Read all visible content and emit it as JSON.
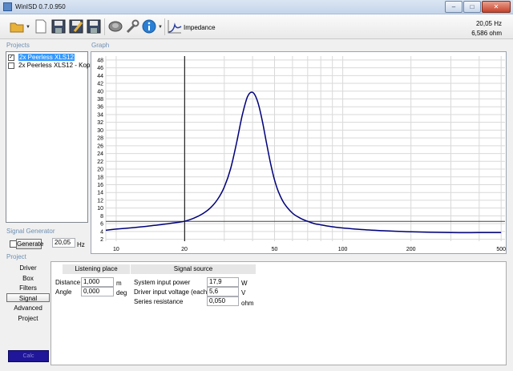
{
  "window": {
    "title": "WinISD 0.7.0.950",
    "min": "–",
    "max": "□",
    "close": "✕"
  },
  "toolbar": {
    "icons": [
      "open-folder",
      "new-document",
      "save",
      "save-as",
      "save-all",
      "speaker-driver",
      "wrench",
      "info"
    ],
    "impedance_label": "Impedance",
    "readout_freq": "20,05 Hz",
    "readout_value": "6,586 ohm"
  },
  "sections": {
    "projects": "Projects",
    "graph": "Graph",
    "signal_generator": "Signal Generator",
    "project": "Project"
  },
  "projects": [
    {
      "name": "2x Peerless XLS12",
      "checked": true,
      "selected": true
    },
    {
      "name": "2x Peerless XLS12 - Kopie",
      "checked": false,
      "selected": false
    }
  ],
  "signal_generator": {
    "button": "Generate",
    "frequency": "20,05",
    "unit": "Hz"
  },
  "project_nav": [
    {
      "label": "Driver",
      "active": false
    },
    {
      "label": "Box",
      "active": false
    },
    {
      "label": "Filters",
      "active": false
    },
    {
      "label": "Signal",
      "active": true
    },
    {
      "label": "Advanced",
      "active": false
    },
    {
      "label": "Project",
      "active": false
    }
  ],
  "listening": {
    "header": "Listening place",
    "distance_label": "Distance",
    "distance_value": "1,000",
    "distance_unit": "m",
    "angle_label": "Angle",
    "angle_value": "0,000",
    "angle_unit": "deg"
  },
  "signal_source": {
    "header": "Signal source",
    "power_label": "System input power",
    "power_value": "17,9",
    "power_unit": "W",
    "voltage_label": "Driver input voltage (each)",
    "voltage_value": "5,6",
    "voltage_unit": "V",
    "resistance_label": "Series resistance",
    "resistance_value": "0,050",
    "resistance_unit": "ohm"
  },
  "status": {
    "text": "Calc"
  },
  "colors": {
    "curve": "#00007a",
    "cursor": "#000000",
    "status_bar": "#1f1699",
    "section_label": "#6d8fb3"
  },
  "chart_data": {
    "type": "line",
    "xscale": "log",
    "xlim": [
      9,
      520
    ],
    "ylim": [
      1.5,
      49
    ],
    "x_ticks": [
      10,
      20,
      50,
      100,
      200,
      500
    ],
    "y_ticks": [
      2,
      4,
      6,
      8,
      10,
      12,
      14,
      16,
      18,
      20,
      22,
      24,
      26,
      28,
      30,
      32,
      34,
      36,
      38,
      40,
      42,
      44,
      46,
      48
    ],
    "cursor": {
      "x": 20.05,
      "y": 6.586
    },
    "series": [
      {
        "x": [
          9,
          10,
          12,
          14,
          16,
          18,
          20,
          22,
          24,
          26,
          28,
          30,
          32,
          34,
          36,
          38,
          40,
          42,
          44,
          46,
          48,
          50,
          52,
          55,
          60,
          65,
          70,
          75,
          80,
          90,
          100,
          120,
          150,
          200,
          300,
          400,
          500
        ],
        "y": [
          4.3,
          4.6,
          5.0,
          5.4,
          5.8,
          6.2,
          6.6,
          7.4,
          8.5,
          10.0,
          12.2,
          15.4,
          20.1,
          26.8,
          33.8,
          38.6,
          39.7,
          37.5,
          32.8,
          26.9,
          21.5,
          17.2,
          14.2,
          11.3,
          8.7,
          7.4,
          6.6,
          6.0,
          5.7,
          5.2,
          4.9,
          4.5,
          4.2,
          3.9,
          3.7,
          3.7,
          3.7
        ]
      }
    ]
  }
}
